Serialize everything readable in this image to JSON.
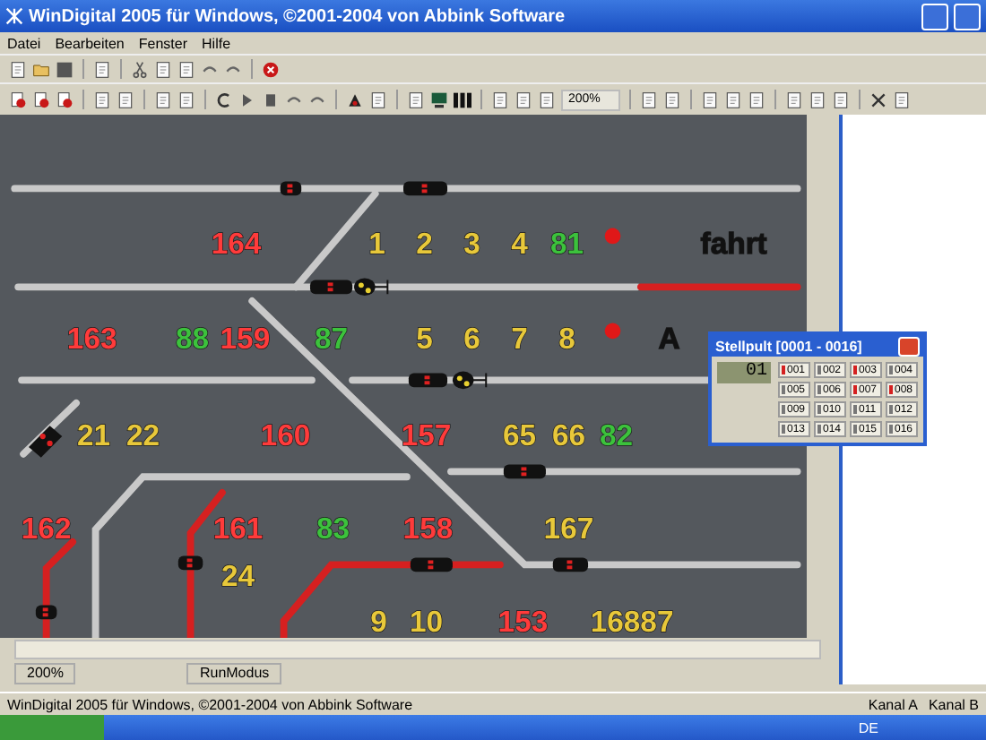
{
  "window": {
    "title": "WinDigital 2005 für Windows, ©2001-2004 von Abbink Software"
  },
  "menu": [
    "Datei",
    "Bearbeiten",
    "Fenster",
    "Hilfe"
  ],
  "toolbar": {
    "zoom": "200%"
  },
  "layout": {
    "labels": [
      {
        "text": "164",
        "color": "#ff3b3b"
      },
      {
        "text": "1",
        "color": "#e8c83a"
      },
      {
        "text": "2",
        "color": "#e8c83a"
      },
      {
        "text": "3",
        "color": "#e8c83a"
      },
      {
        "text": "4",
        "color": "#e8c83a"
      },
      {
        "text": "81",
        "color": "#3cc23c"
      },
      {
        "text": "fahrt",
        "color": "#111111"
      },
      {
        "text": "163",
        "color": "#ff3b3b"
      },
      {
        "text": "88",
        "color": "#3cc23c"
      },
      {
        "text": "159",
        "color": "#ff3b3b"
      },
      {
        "text": "87",
        "color": "#3cc23c"
      },
      {
        "text": "5",
        "color": "#e8c83a"
      },
      {
        "text": "6",
        "color": "#e8c83a"
      },
      {
        "text": "7",
        "color": "#e8c83a"
      },
      {
        "text": "8",
        "color": "#e8c83a"
      },
      {
        "text": "A",
        "color": "#111111"
      },
      {
        "text": "21",
        "color": "#e8c83a"
      },
      {
        "text": "22",
        "color": "#e8c83a"
      },
      {
        "text": "160",
        "color": "#ff3b3b"
      },
      {
        "text": "157",
        "color": "#ff3b3b"
      },
      {
        "text": "65",
        "color": "#e8c83a"
      },
      {
        "text": "66",
        "color": "#e8c83a"
      },
      {
        "text": "82",
        "color": "#3cc23c"
      },
      {
        "text": "162",
        "color": "#ff3b3b"
      },
      {
        "text": "161",
        "color": "#ff3b3b"
      },
      {
        "text": "83",
        "color": "#3cc23c"
      },
      {
        "text": "158",
        "color": "#ff3b3b"
      },
      {
        "text": "167",
        "color": "#e8c83a"
      },
      {
        "text": "24",
        "color": "#e8c83a"
      },
      {
        "text": "9",
        "color": "#e8c83a"
      },
      {
        "text": "10",
        "color": "#e8c83a"
      },
      {
        "text": "153",
        "color": "#ff3b3b"
      },
      {
        "text": "16887",
        "color": "#e8c83a"
      }
    ]
  },
  "stellpult": {
    "title": "Stellpult [0001 - 0016]",
    "display": "01",
    "buttons": [
      {
        "label": "001",
        "on": true
      },
      {
        "label": "002",
        "on": false
      },
      {
        "label": "003",
        "on": true
      },
      {
        "label": "004",
        "on": false
      },
      {
        "label": "005",
        "on": false
      },
      {
        "label": "006",
        "on": false
      },
      {
        "label": "007",
        "on": true
      },
      {
        "label": "008",
        "on": true
      },
      {
        "label": "009",
        "on": false
      },
      {
        "label": "010",
        "on": false
      },
      {
        "label": "011",
        "on": false
      },
      {
        "label": "012",
        "on": false
      },
      {
        "label": "013",
        "on": false
      },
      {
        "label": "014",
        "on": false
      },
      {
        "label": "015",
        "on": false
      },
      {
        "label": "016",
        "on": false
      }
    ]
  },
  "child_status": [
    "200%",
    "RunModus"
  ],
  "status_bar": {
    "text": "WinDigital 2005 für Windows, ©2001-2004 von Abbink Software",
    "channel_a": "Kanal A",
    "channel_b": "Kanal B"
  },
  "taskbar": {
    "language": "DE"
  }
}
